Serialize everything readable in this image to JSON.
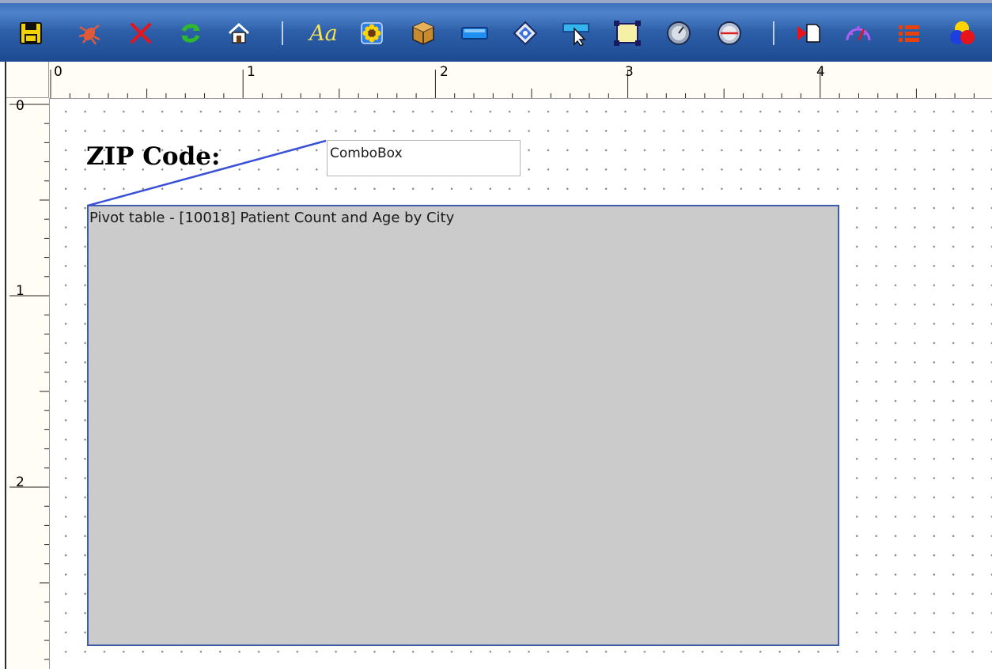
{
  "toolbar": {
    "icons": [
      "save-icon",
      "bug-icon",
      "delete-icon",
      "refresh-icon",
      "home-icon",
      "font-icon",
      "image-icon",
      "box-icon",
      "rectangle-icon",
      "diamond-icon",
      "pointer-icon",
      "resize-icon",
      "gauge-icon",
      "dial-icon",
      "play-page-icon",
      "sparkle-icon",
      "list-icon",
      "colors-icon"
    ],
    "font_text": "Aa"
  },
  "ruler": {
    "h_labels": [
      "0",
      "1",
      "2",
      "3",
      "4"
    ],
    "v_labels": [
      "0",
      "1",
      "2"
    ]
  },
  "canvas": {
    "zip_label": "ZIP Code:",
    "combobox_text": "ComboBox",
    "pivot_title": "Pivot table - [10018] Patient Count and Age by City"
  },
  "colors": {
    "toolbar": "#2c5fa8",
    "pivot_fill": "#cbcbcb",
    "pivot_border": "#3e5ca8",
    "link_line": "#3a50d8"
  }
}
